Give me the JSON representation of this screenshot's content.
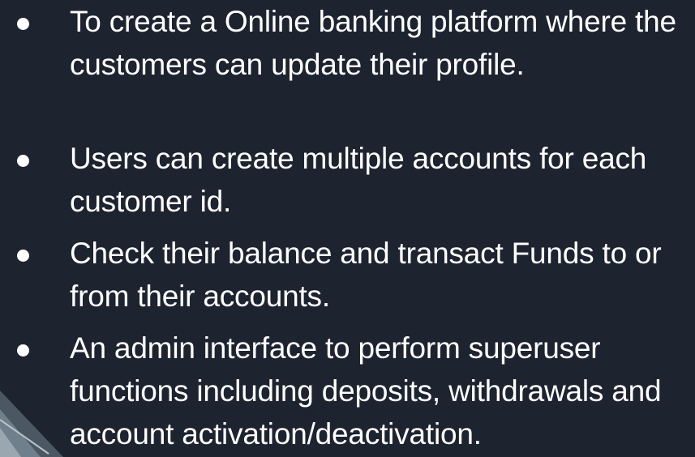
{
  "slide": {
    "background_color": "#1e2330",
    "bullets": [
      {
        "text": "To create a Online banking platform where the customers can update their profile."
      },
      {
        "text": "Users can create multiple accounts for each customer id."
      },
      {
        "text": "Check their balance and transact Funds to or from their accounts."
      },
      {
        "text": "An admin interface to perform superuser functions including deposits, withdrawals and account activation/deactivation."
      }
    ]
  }
}
